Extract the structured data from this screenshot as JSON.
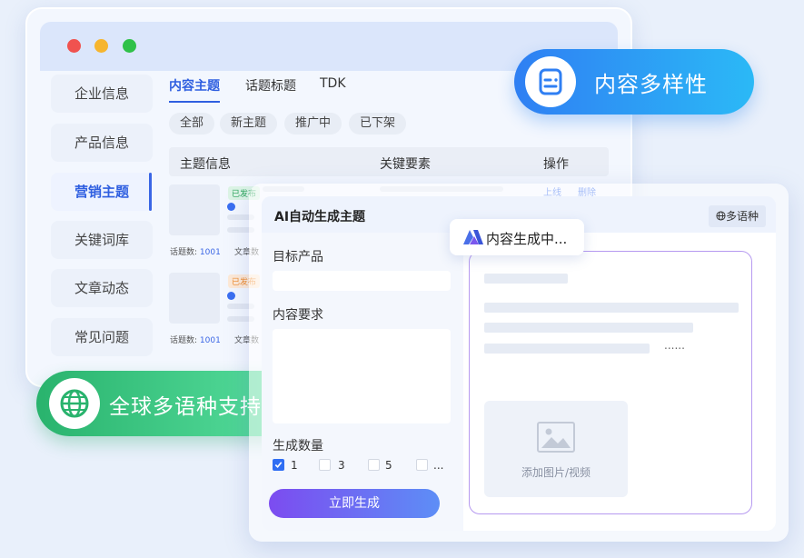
{
  "colors": {
    "accent": "#2f5fe0",
    "pill_blue": "#2f7ff3",
    "pill_green": "#29b36d",
    "button_purple": "#7c4cf0"
  },
  "window": {
    "sidebar": [
      {
        "label": "企业信息"
      },
      {
        "label": "产品信息"
      },
      {
        "label": "营销主题",
        "active": true
      },
      {
        "label": "关键词库"
      },
      {
        "label": "文章动态"
      },
      {
        "label": "常见问题"
      }
    ],
    "tabs": [
      {
        "label": "内容主题",
        "active": true
      },
      {
        "label": "话题标题"
      },
      {
        "label": "TDK"
      }
    ],
    "filters": [
      "全部",
      "新主题",
      "推广中",
      "已下架"
    ],
    "table": {
      "headers": [
        "主题信息",
        "关键要素",
        "操作"
      ],
      "rows": [
        {
          "status": "已发布",
          "count_label": "话题数:",
          "count": "1001",
          "articles_label": "文章数",
          "actions": [
            "上线",
            "删除"
          ]
        },
        {
          "status": "已发布",
          "count_label": "话题数:",
          "count": "1001",
          "articles_label": "文章数"
        }
      ]
    }
  },
  "badges": {
    "diversity": {
      "label": "内容多样性",
      "icon": "document-icon"
    },
    "multilang": {
      "label": "全球多语种支持",
      "icon": "globe-icon"
    }
  },
  "dialog": {
    "title": "AI自动生成主题",
    "lang_button": "多语种",
    "product_label": "目标产品",
    "product_value": "",
    "requirement_label": "内容要求",
    "requirement_value": "",
    "quantity_label": "生成数量",
    "quantity_options": [
      {
        "label": "1",
        "checked": true
      },
      {
        "label": "3",
        "checked": false
      },
      {
        "label": "5",
        "checked": false
      },
      {
        "label": "...",
        "checked": false
      }
    ],
    "generate_button": "立即生成",
    "generating_label": "内容生成中...",
    "preview_ellipsis": "......",
    "media_placeholder": "添加图片/视频"
  }
}
